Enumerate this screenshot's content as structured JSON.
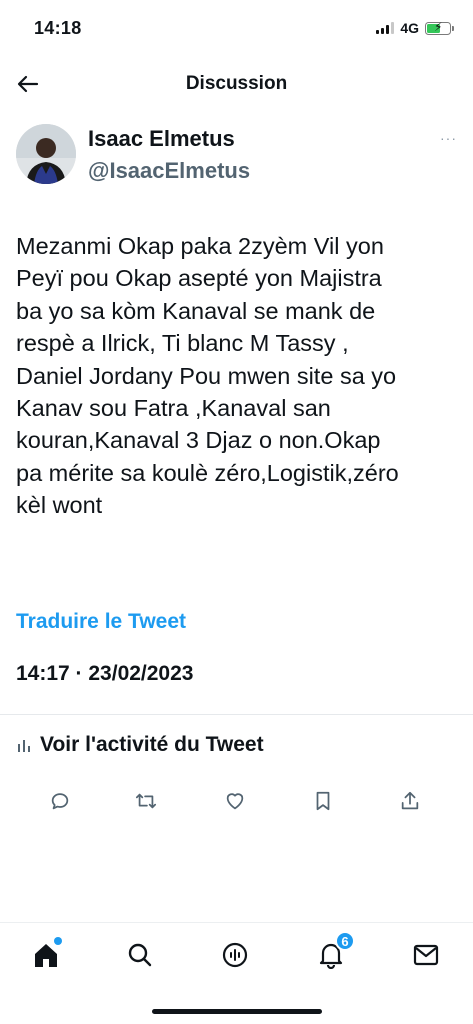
{
  "status_bar": {
    "time": "14:18",
    "network": "4G"
  },
  "header": {
    "title": "Discussion"
  },
  "tweet": {
    "author_name": "Isaac Elmetus",
    "author_handle": "@IsaacElmetus",
    "more_label": "···",
    "text": "Mezanmi Okap paka 2zyèm Vil yon\nPeyï pou Okap asepté yon Majistra\nba yo sa kòm Kanaval se mank de\nrespè a Ilrick, Ti blanc M Tassy ,\nDaniel Jordany Pou mwen site sa yo\nKanav sou Fatra ,Kanaval san\nkouran,Kanaval 3 Djaz o non.Okap\npa mérite sa koulè zéro,Logistik,zéro\nkèl wont",
    "translate_label": "Traduire le Tweet",
    "timestamp": "14:17 · 23/02/2023",
    "activity_label": "Voir l'activité du Tweet"
  },
  "actions": [
    {
      "name": "reply",
      "icon": "reply-icon"
    },
    {
      "name": "retweet",
      "icon": "retweet-icon"
    },
    {
      "name": "like",
      "icon": "heart-icon"
    },
    {
      "name": "bookmark",
      "icon": "bookmark-icon"
    },
    {
      "name": "share",
      "icon": "share-icon"
    }
  ],
  "tabbar": {
    "items": [
      {
        "name": "home",
        "icon": "home-icon"
      },
      {
        "name": "search",
        "icon": "search-icon"
      },
      {
        "name": "spaces",
        "icon": "spaces-icon"
      },
      {
        "name": "notifications",
        "icon": "bell-icon",
        "badge": "6"
      },
      {
        "name": "messages",
        "icon": "mail-icon"
      }
    ]
  },
  "colors": {
    "accent": "#1d9bf0",
    "text": "#0f1419",
    "secondary": "#536471"
  }
}
